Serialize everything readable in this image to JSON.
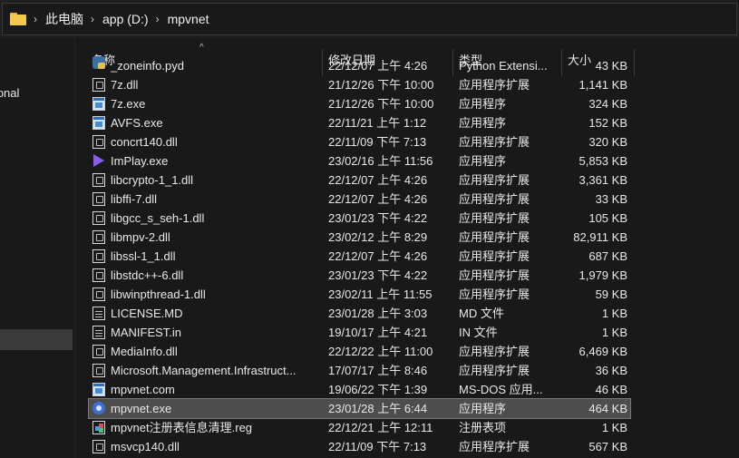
{
  "address": {
    "crumbs": [
      "此电脑",
      "app (D:)",
      "mpvnet"
    ]
  },
  "nav": {
    "onedrive_partial": "rsonal"
  },
  "columns": {
    "name": "名称",
    "date": "修改日期",
    "type": "类型",
    "size": "大小"
  },
  "files": [
    {
      "name": "_zoneinfo.pyd",
      "date": "22/12/07 上午 4:26",
      "type": "Python Extensi...",
      "size": "43 KB",
      "icon": "python-icon"
    },
    {
      "name": "7z.dll",
      "date": "21/12/26 下午 10:00",
      "type": "应用程序扩展",
      "size": "1,141 KB",
      "icon": "dll-icon"
    },
    {
      "name": "7z.exe",
      "date": "21/12/26 下午 10:00",
      "type": "应用程序",
      "size": "324 KB",
      "icon": "exe-icon"
    },
    {
      "name": "AVFS.exe",
      "date": "22/11/21 上午 1:12",
      "type": "应用程序",
      "size": "152 KB",
      "icon": "exe-icon"
    },
    {
      "name": "concrt140.dll",
      "date": "22/11/09 下午 7:13",
      "type": "应用程序扩展",
      "size": "320 KB",
      "icon": "dll-icon"
    },
    {
      "name": "ImPlay.exe",
      "date": "23/02/16 上午 11:56",
      "type": "应用程序",
      "size": "5,853 KB",
      "icon": "play-icon"
    },
    {
      "name": "libcrypto-1_1.dll",
      "date": "22/12/07 上午 4:26",
      "type": "应用程序扩展",
      "size": "3,361 KB",
      "icon": "dll-icon"
    },
    {
      "name": "libffi-7.dll",
      "date": "22/12/07 上午 4:26",
      "type": "应用程序扩展",
      "size": "33 KB",
      "icon": "dll-icon"
    },
    {
      "name": "libgcc_s_seh-1.dll",
      "date": "23/01/23 下午 4:22",
      "type": "应用程序扩展",
      "size": "105 KB",
      "icon": "dll-icon"
    },
    {
      "name": "libmpv-2.dll",
      "date": "23/02/12 上午 8:29",
      "type": "应用程序扩展",
      "size": "82,911 KB",
      "icon": "dll-icon"
    },
    {
      "name": "libssl-1_1.dll",
      "date": "22/12/07 上午 4:26",
      "type": "应用程序扩展",
      "size": "687 KB",
      "icon": "dll-icon"
    },
    {
      "name": "libstdc++-6.dll",
      "date": "23/01/23 下午 4:22",
      "type": "应用程序扩展",
      "size": "1,979 KB",
      "icon": "dll-icon"
    },
    {
      "name": "libwinpthread-1.dll",
      "date": "23/02/11 上午 11:55",
      "type": "应用程序扩展",
      "size": "59 KB",
      "icon": "dll-icon"
    },
    {
      "name": "LICENSE.MD",
      "date": "23/01/28 上午 3:03",
      "type": "MD 文件",
      "size": "1 KB",
      "icon": "doc-icon"
    },
    {
      "name": "MANIFEST.in",
      "date": "19/10/17 上午 4:21",
      "type": "IN 文件",
      "size": "1 KB",
      "icon": "doc-icon"
    },
    {
      "name": "MediaInfo.dll",
      "date": "22/12/22 上午 11:00",
      "type": "应用程序扩展",
      "size": "6,469 KB",
      "icon": "dll-icon"
    },
    {
      "name": "Microsoft.Management.Infrastruct...",
      "date": "17/07/17 上午 8:46",
      "type": "应用程序扩展",
      "size": "36 KB",
      "icon": "dll-icon"
    },
    {
      "name": "mpvnet.com",
      "date": "19/06/22 下午 1:39",
      "type": "MS-DOS 应用...",
      "size": "46 KB",
      "icon": "exe-icon"
    },
    {
      "name": "mpvnet.exe",
      "date": "23/01/28 上午 6:44",
      "type": "应用程序",
      "size": "464 KB",
      "icon": "mpv-icon",
      "selected": true
    },
    {
      "name": "mpvnet注册表信息清理.reg",
      "date": "22/12/21 上午 12:11",
      "type": "注册表项",
      "size": "1 KB",
      "icon": "reg-icon"
    },
    {
      "name": "msvcp140.dll",
      "date": "22/11/09 下午 7:13",
      "type": "应用程序扩展",
      "size": "567 KB",
      "icon": "dll-icon"
    }
  ]
}
